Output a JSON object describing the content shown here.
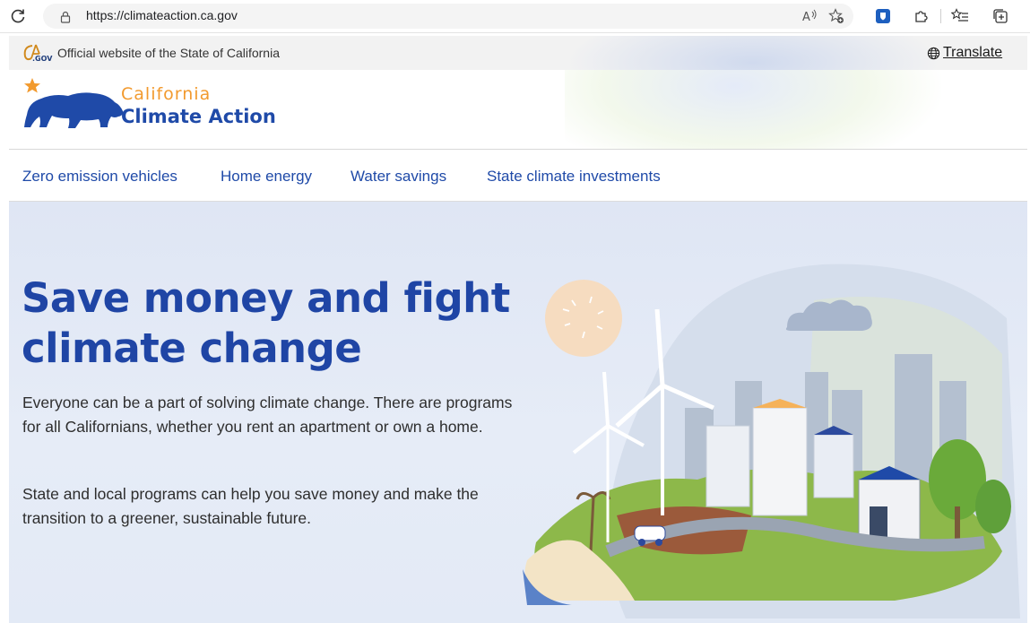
{
  "browser": {
    "url": "https://climateaction.ca.gov",
    "read_aloud_icon": "read-aloud-icon",
    "favorite_icon": "add-favorite-icon",
    "extension_icon": "shield-extension-icon",
    "extensions_icon": "puzzle-icon",
    "favorites_icon": "favorites-list-icon",
    "collections_icon": "collections-icon"
  },
  "banner": {
    "official_text": "Official website of the State of California",
    "translate_label": "Translate"
  },
  "brand": {
    "line1": "California",
    "line2": "Climate Action"
  },
  "nav": {
    "items": [
      {
        "label": "Zero emission vehicles"
      },
      {
        "label": "Home energy"
      },
      {
        "label": "Water savings"
      },
      {
        "label": "State climate investments"
      }
    ]
  },
  "hero": {
    "title": "Save money and fight climate change",
    "paragraph1": "Everyone can be a part of solving climate change. There are programs for all Californians, whether you rent an apartment or own a home.",
    "paragraph2": "State and local programs can help you save money and make the transition to a greener, sustainable future."
  },
  "colors": {
    "brand_blue": "#1f45a5",
    "brand_orange": "#f29a2e",
    "hero_bg": "#e3eaf6"
  }
}
